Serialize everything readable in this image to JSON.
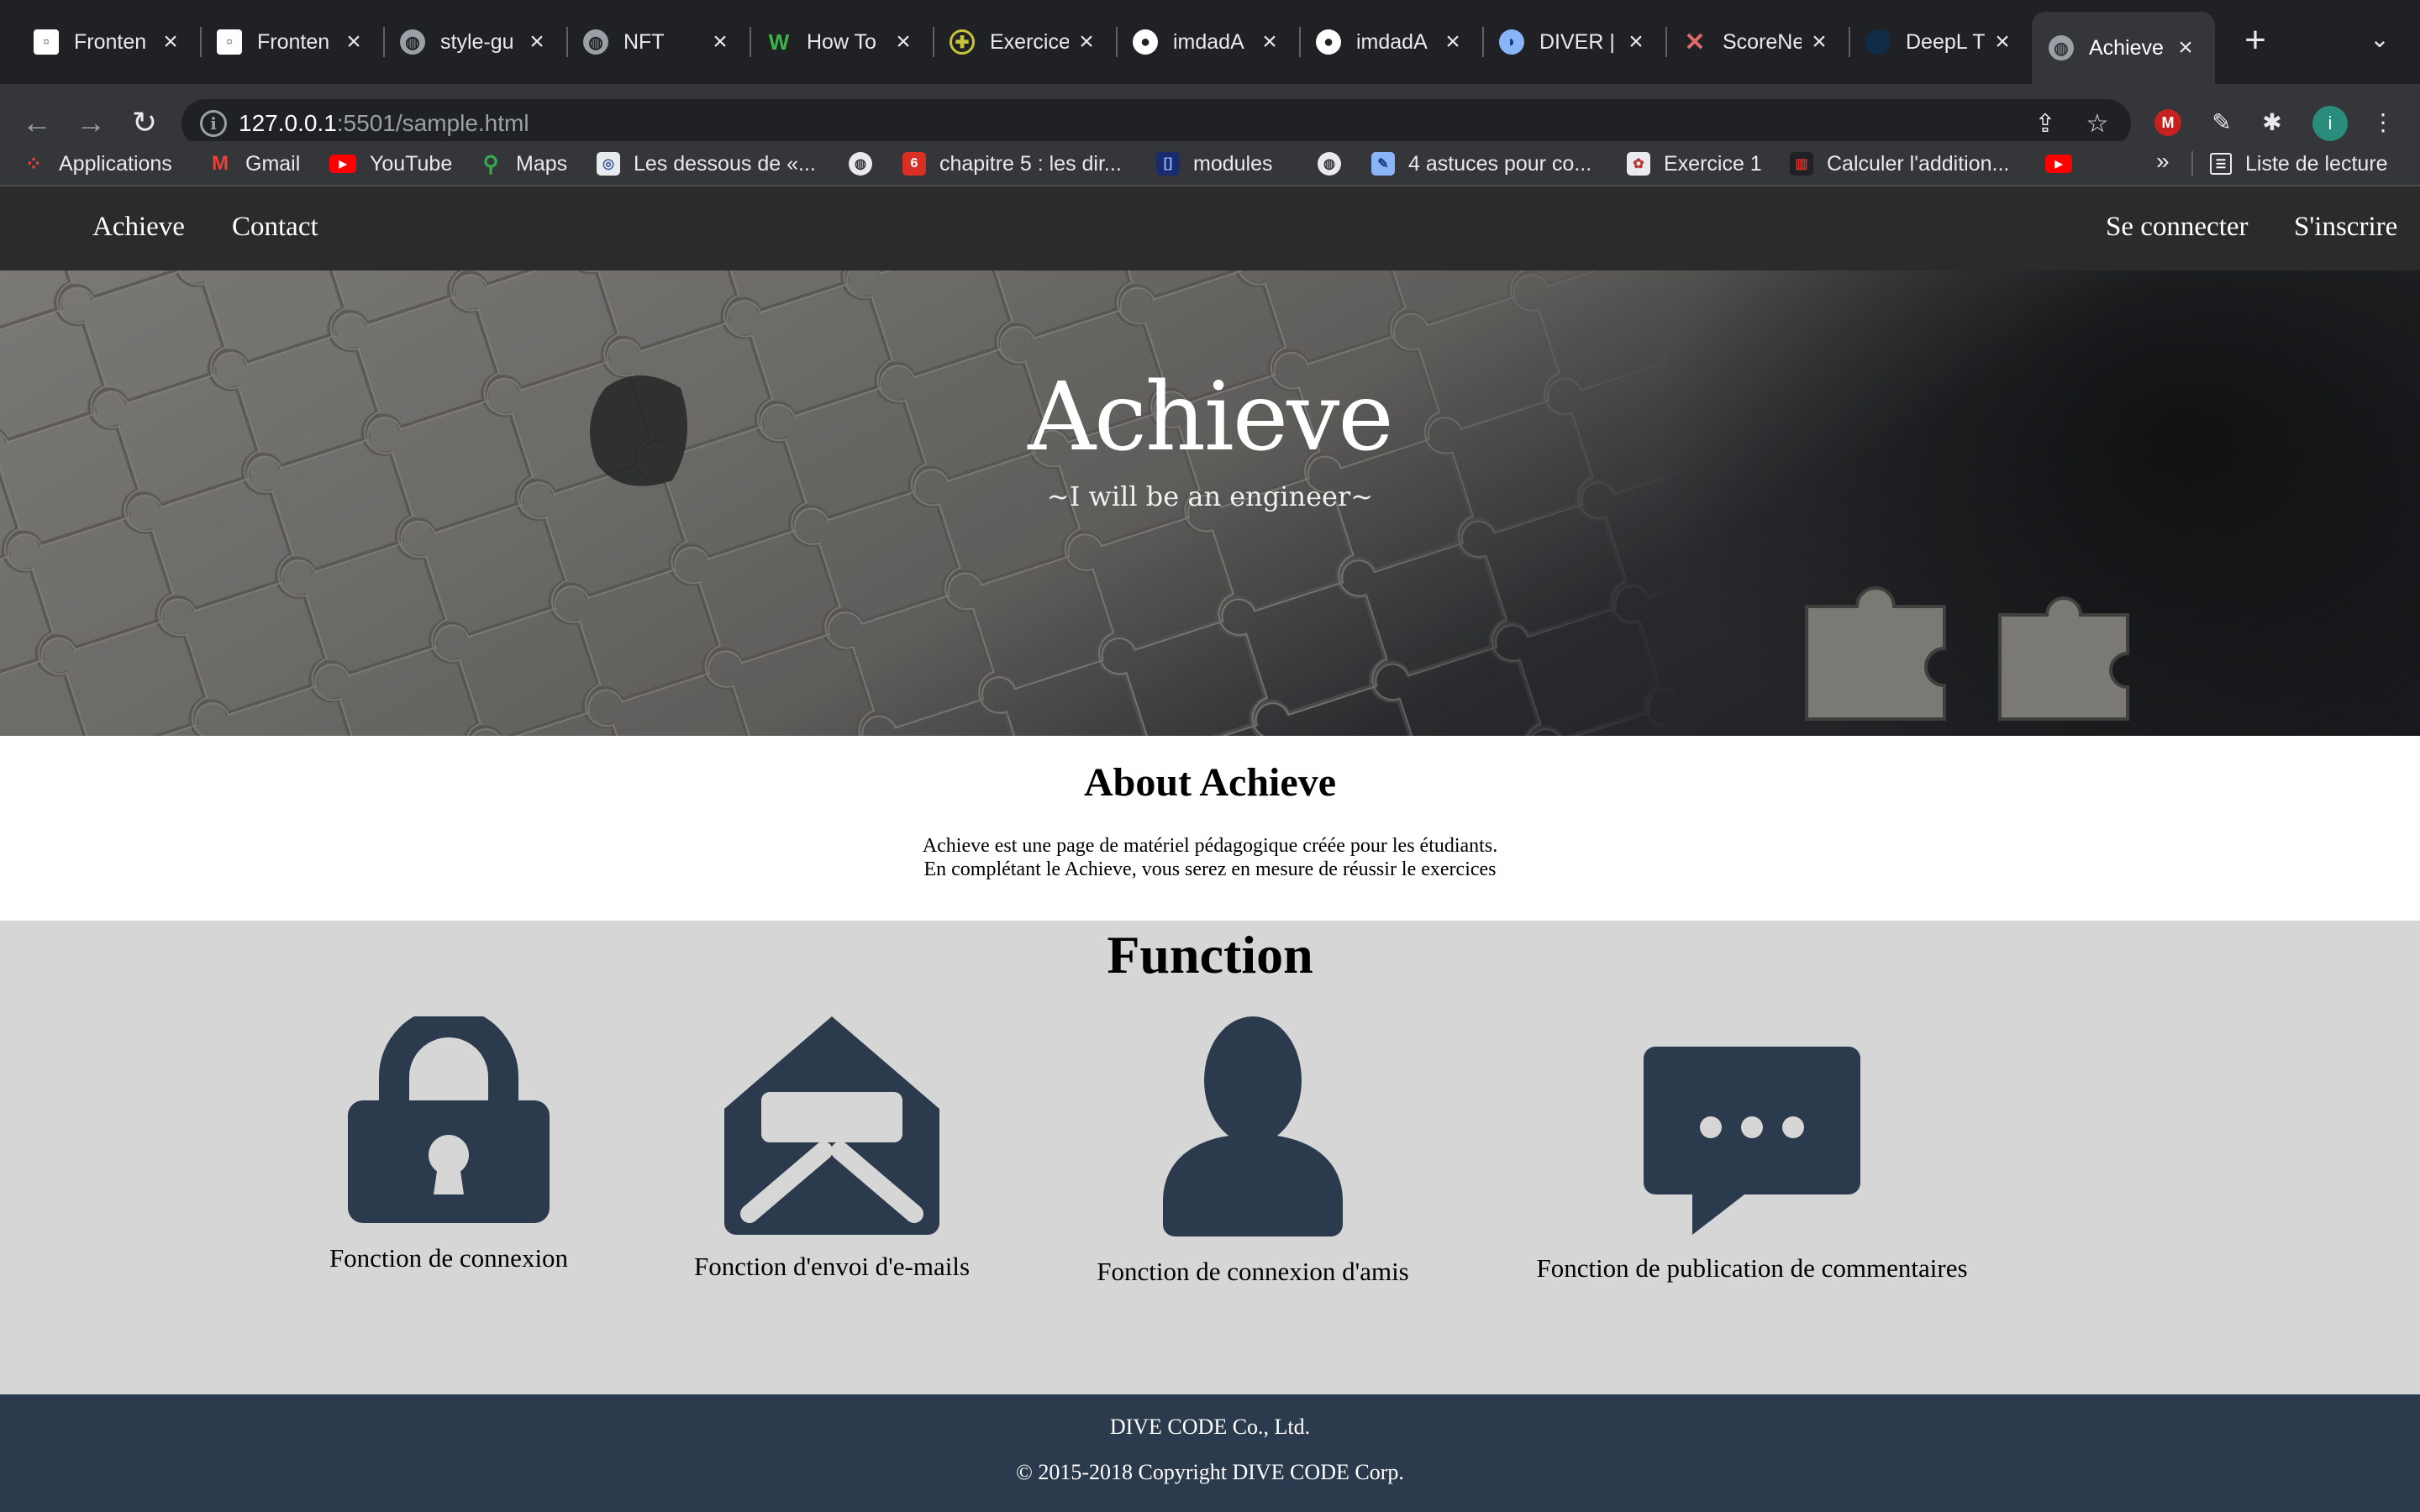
{
  "browser": {
    "tabs": [
      {
        "title": "Fronten",
        "icon": "document-icon"
      },
      {
        "title": "Fronten",
        "icon": "document-icon"
      },
      {
        "title": "style-gu",
        "icon": "globe-icon"
      },
      {
        "title": "NFT",
        "icon": "globe-icon"
      },
      {
        "title": "How To",
        "icon": "w-logo-icon"
      },
      {
        "title": "Exercice",
        "icon": "globe-yellow-icon"
      },
      {
        "title": "imdadA",
        "icon": "github-icon"
      },
      {
        "title": "imdadA",
        "icon": "github-icon"
      },
      {
        "title": "DIVER |",
        "icon": "diver-icon"
      },
      {
        "title": "ScoreNe",
        "icon": "x-logo-icon"
      },
      {
        "title": "DeepL T",
        "icon": "deepl-icon"
      },
      {
        "title": "Achieve",
        "icon": "globe-icon"
      }
    ],
    "url_host": "127.0.0.1",
    "url_rest": ":5501/sample.html",
    "bookmarks": [
      {
        "label": "Applications",
        "icon": "apps-grid-icon"
      },
      {
        "label": "Gmail",
        "icon": "gmail-icon"
      },
      {
        "label": "YouTube",
        "icon": "youtube-icon"
      },
      {
        "label": "Maps",
        "icon": "maps-icon"
      },
      {
        "label": "Les dessous de «...",
        "icon": "site-icon"
      },
      {
        "label": "",
        "icon": "globe-icon"
      },
      {
        "label": "chapitre 5 : les dir...",
        "icon": "site-icon"
      },
      {
        "label": "modules",
        "icon": "site-icon"
      },
      {
        "label": "",
        "icon": "globe-icon"
      },
      {
        "label": "4 astuces pour co...",
        "icon": "site-icon"
      },
      {
        "label": "Exercice 1",
        "icon": "site-icon"
      },
      {
        "label": "Calculer l'addition...",
        "icon": "site-icon"
      },
      {
        "label": "",
        "icon": "youtube-icon"
      }
    ],
    "more_bookmarks": "»",
    "reading_list": "Liste de lecture",
    "avatar_letter": "i"
  },
  "site": {
    "nav": {
      "brand": "Achieve",
      "contact": "Contact",
      "login": "Se connecter",
      "signup": "S'inscrire"
    },
    "hero": {
      "title": "Achieve",
      "subtitle": "~I will be an engineer~"
    },
    "about": {
      "heading": "About Achieve",
      "line1": "Achieve est une page de matériel pédagogique créée pour les étudiants.",
      "line2": "En complétant le Achieve, vous serez en mesure de réussir le exercices"
    },
    "function": {
      "heading": "Function",
      "features": [
        {
          "label": "Fonction de connexion",
          "icon": "lock-icon"
        },
        {
          "label": "Fonction d'envoi d'e-mails",
          "icon": "open-envelope-icon"
        },
        {
          "label": "Fonction de connexion d'amis",
          "icon": "user-icon"
        },
        {
          "label": "Fonction de publication de commentaires",
          "icon": "comment-icon"
        }
      ]
    },
    "footer": {
      "company": "DIVE  CODE Co., Ltd.",
      "copyright": "© 2015-2018 Copyright DIVE  CODE Corp."
    }
  },
  "colors": {
    "icon": "#2b3a4c",
    "nav_bg": "#2b2b2b",
    "function_bg": "#d6d6d6",
    "footer_bg": "#2b3a4c"
  }
}
